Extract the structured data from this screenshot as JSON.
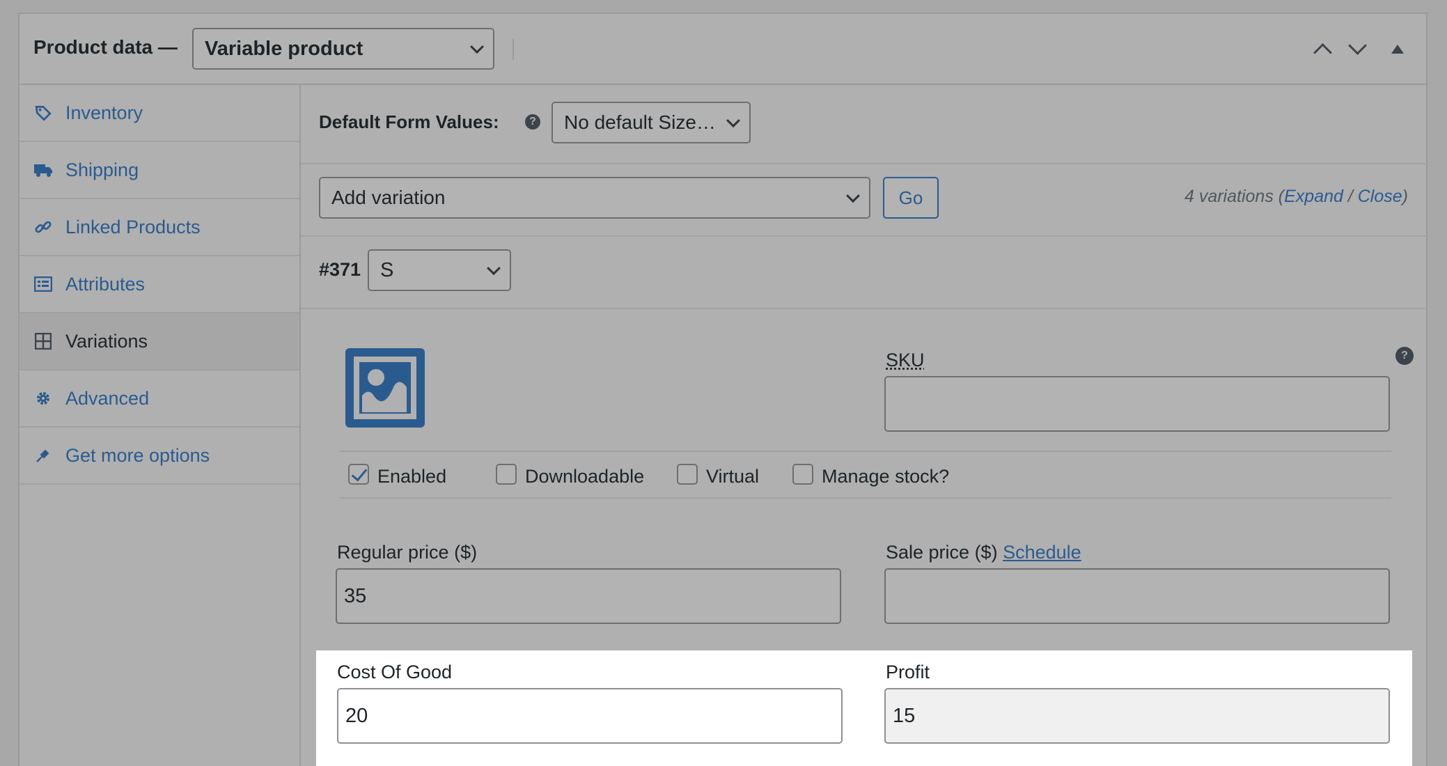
{
  "header": {
    "title": "Product data —",
    "product_type": "Variable product"
  },
  "sidebar": {
    "items": [
      {
        "label": "Inventory",
        "icon": "tag-icon"
      },
      {
        "label": "Shipping",
        "icon": "truck-icon"
      },
      {
        "label": "Linked Products",
        "icon": "link-icon"
      },
      {
        "label": "Attributes",
        "icon": "list-icon"
      },
      {
        "label": "Variations",
        "icon": "grid-icon"
      },
      {
        "label": "Advanced",
        "icon": "gear-icon"
      },
      {
        "label": "Get more options",
        "icon": "plug-icon"
      }
    ]
  },
  "defaults": {
    "label": "Default Form Values:",
    "help": "?",
    "size_value": "No default Size…"
  },
  "variation_bar": {
    "add_value": "Add variation",
    "go_label": "Go",
    "count_text": "4 variations",
    "open_paren": "(",
    "expand": "Expand",
    "slash": " / ",
    "close": "Close",
    "close_paren": ")"
  },
  "variation": {
    "id": "#371",
    "size": "S",
    "sku_label": "SKU",
    "sku_value": "",
    "checks": [
      {
        "label": "Enabled",
        "checked": true
      },
      {
        "label": "Downloadable",
        "checked": false
      },
      {
        "label": "Virtual",
        "checked": false
      },
      {
        "label": "Manage stock?",
        "checked": false
      }
    ],
    "regular_price_label": "Regular price ($)",
    "regular_price": "35",
    "sale_price_label": "Sale price ($)",
    "schedule_label": "Schedule",
    "sale_price": "",
    "cost_label": "Cost Of Good",
    "cost_value": "20",
    "profit_label": "Profit",
    "profit_value": "15"
  }
}
